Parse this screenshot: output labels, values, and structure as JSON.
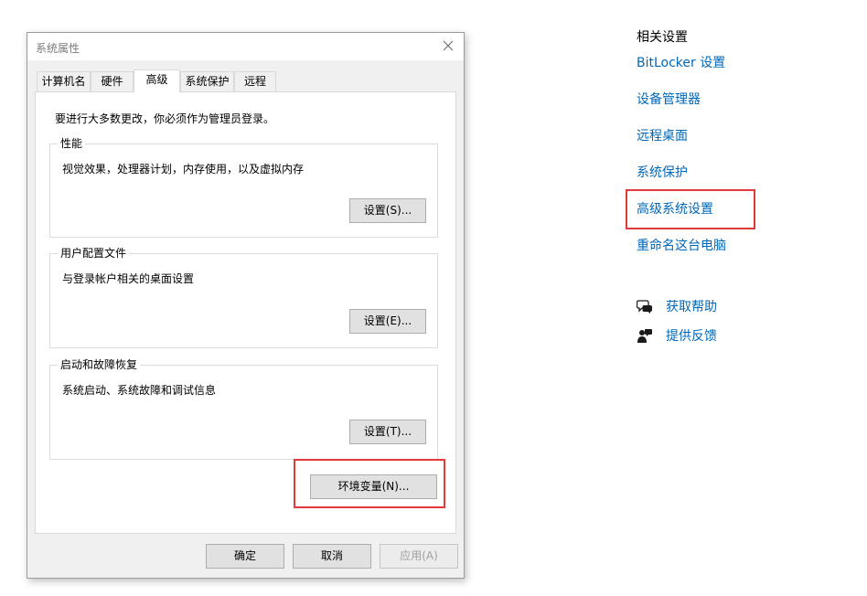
{
  "dialog": {
    "title": "系统属性",
    "tabs": [
      "计算机名",
      "硬件",
      "高级",
      "系统保护",
      "远程"
    ],
    "active_tab": "高级",
    "admin_note": "要进行大多数更改，你必须作为管理员登录。",
    "groups": {
      "performance": {
        "legend": "性能",
        "description": "视觉效果，处理器计划，内存使用，以及虚拟内存",
        "button": "设置(S)..."
      },
      "user_profiles": {
        "legend": "用户配置文件",
        "description": "与登录帐户相关的桌面设置",
        "button": "设置(E)..."
      },
      "startup_recovery": {
        "legend": "启动和故障恢复",
        "description": "系统启动、系统故障和调试信息",
        "button": "设置(T)..."
      }
    },
    "env_button": "环境变量(N)...",
    "footer": {
      "ok": "确定",
      "cancel": "取消",
      "apply": "应用(A)"
    }
  },
  "related_settings": {
    "title": "相关设置",
    "links": [
      "BitLocker 设置",
      "设备管理器",
      "远程桌面",
      "系统保护",
      "高级系统设置",
      "重命名这台电脑"
    ],
    "help": "获取帮助",
    "feedback": "提供反馈",
    "link_color": "#0067b8",
    "highlight_color": "#e23a3a"
  }
}
